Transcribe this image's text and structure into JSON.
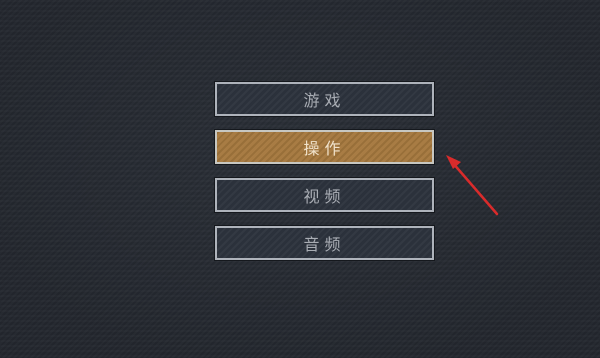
{
  "menu": {
    "items": [
      {
        "label": "游戏",
        "selected": false
      },
      {
        "label": "操作",
        "selected": true
      },
      {
        "label": "视频",
        "selected": false
      },
      {
        "label": "音频",
        "selected": false
      }
    ]
  },
  "colors": {
    "background": "#262a31",
    "button_fill": "#2b313b",
    "button_border": "#aeb3bb",
    "selected_fill": "#a5783e",
    "arrow": "#d92b2b"
  }
}
